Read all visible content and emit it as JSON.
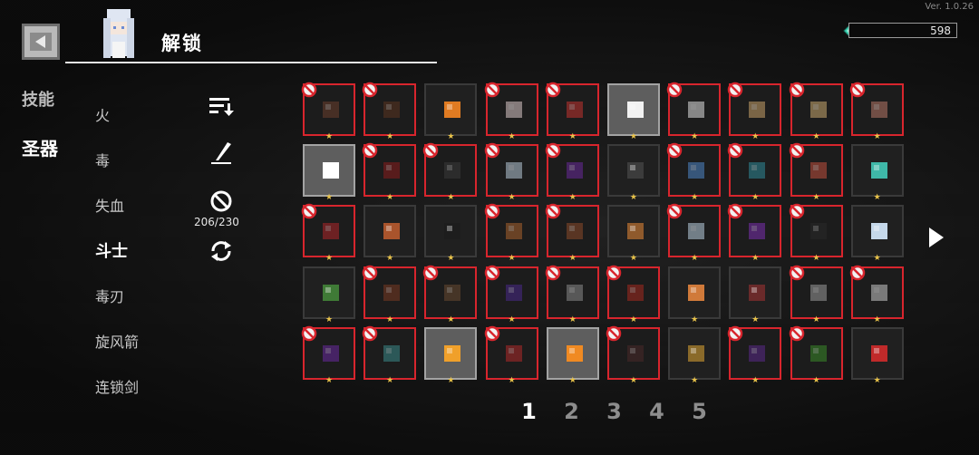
{
  "version": "Ver. 1.0.26",
  "header": {
    "title": "解锁",
    "gem_count": "598"
  },
  "nav": {
    "skills": "技能",
    "relics": "圣器"
  },
  "categories": [
    "火",
    "毒",
    "失血",
    "斗士",
    "毒刃",
    "旋风箭",
    "连锁剑"
  ],
  "active_category": "斗士",
  "unlock_counter": "206/230",
  "icons": {
    "back": "back-arrow-icon",
    "gem": "gem-icon",
    "sort": "sort-icon",
    "pen": "pen-icon",
    "ban": "ban-icon",
    "refresh": "refresh-icon",
    "next": "next-page-arrow-icon",
    "lock": "locked-ban-icon",
    "star": "star-icon"
  },
  "colors": {
    "locked_border": "#d8252d",
    "unlocked_bg": "#5e5e5e",
    "star": "#e9c34a"
  },
  "pages": [
    "1",
    "2",
    "3",
    "4",
    "5"
  ],
  "active_page": "1",
  "grid": [
    [
      {
        "icon": "round-brown-stone",
        "state": "locked"
      },
      {
        "icon": "brown-fruit",
        "state": "locked"
      },
      {
        "icon": "orange-crystal",
        "state": "normal"
      },
      {
        "icon": "white-feather",
        "state": "locked"
      },
      {
        "icon": "red-potion",
        "state": "locked"
      },
      {
        "icon": "fox-mask",
        "state": "unlocked"
      },
      {
        "icon": "skull",
        "state": "locked"
      },
      {
        "icon": "paper-bag",
        "state": "locked"
      },
      {
        "icon": "paper-bag-2",
        "state": "locked"
      },
      {
        "icon": "parchment",
        "state": "locked"
      }
    ],
    [
      {
        "icon": "white-gem",
        "state": "unlocked"
      },
      {
        "icon": "red-spider",
        "state": "locked"
      },
      {
        "icon": "black-stone",
        "state": "locked"
      },
      {
        "icon": "silver-shard",
        "state": "locked"
      },
      {
        "icon": "purple-crystal",
        "state": "locked"
      },
      {
        "icon": "dark-boot",
        "state": "normal"
      },
      {
        "icon": "blue-fist",
        "state": "locked"
      },
      {
        "icon": "teal-tree",
        "state": "locked"
      },
      {
        "icon": "red-mushroom",
        "state": "locked"
      },
      {
        "icon": "teal-coins",
        "state": "normal"
      }
    ],
    [
      {
        "icon": "red-scarf",
        "state": "locked"
      },
      {
        "icon": "clay-jar",
        "state": "normal"
      },
      {
        "icon": "black-spoon",
        "state": "normal"
      },
      {
        "icon": "wooden-boomerang",
        "state": "locked"
      },
      {
        "icon": "leather-glove",
        "state": "locked"
      },
      {
        "icon": "wooden-plank",
        "state": "normal"
      },
      {
        "icon": "snow-globe",
        "state": "locked"
      },
      {
        "icon": "purple-lantern",
        "state": "locked"
      },
      {
        "icon": "black-book",
        "state": "locked"
      },
      {
        "icon": "ice-cube",
        "state": "normal"
      }
    ],
    [
      {
        "icon": "green-orb",
        "state": "normal"
      },
      {
        "icon": "crossbow",
        "state": "locked"
      },
      {
        "icon": "brown-bundle",
        "state": "locked"
      },
      {
        "icon": "purple-snake",
        "state": "locked"
      },
      {
        "icon": "crossed-blades",
        "state": "locked"
      },
      {
        "icon": "red-leaf",
        "state": "locked"
      },
      {
        "icon": "orange-map",
        "state": "normal"
      },
      {
        "icon": "red-feather",
        "state": "normal"
      },
      {
        "icon": "dagger",
        "state": "locked"
      },
      {
        "icon": "knife",
        "state": "locked"
      }
    ],
    [
      {
        "icon": "purple-eye",
        "state": "locked"
      },
      {
        "icon": "teal-creature",
        "state": "locked"
      },
      {
        "icon": "gold-bars",
        "state": "unlocked"
      },
      {
        "icon": "red-boot",
        "state": "locked"
      },
      {
        "icon": "orange-orb",
        "state": "unlocked"
      },
      {
        "icon": "dark-spider",
        "state": "locked"
      },
      {
        "icon": "gold-skull",
        "state": "normal"
      },
      {
        "icon": "purple-urn",
        "state": "locked"
      },
      {
        "icon": "green-berries",
        "state": "locked"
      },
      {
        "icon": "red-gem",
        "state": "normal"
      }
    ]
  ]
}
